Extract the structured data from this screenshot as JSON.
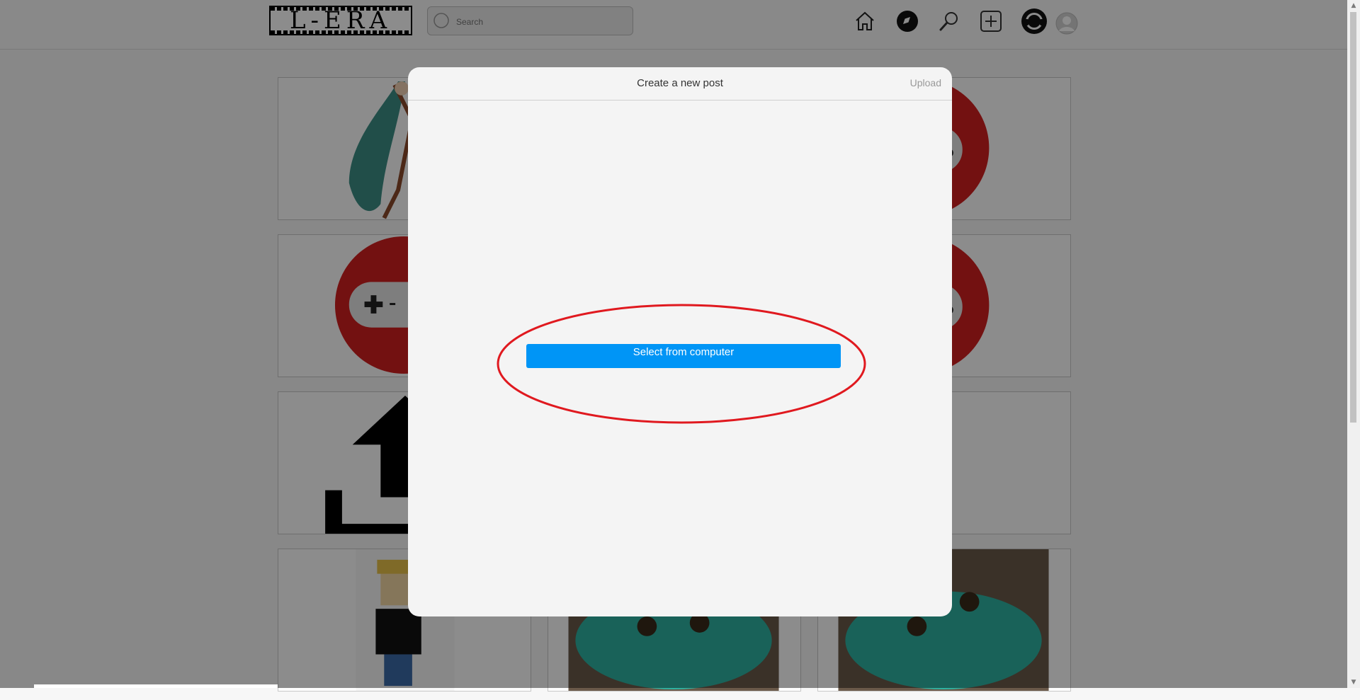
{
  "nav": {
    "logo_text": "L-ERA",
    "search_placeholder": "Search",
    "icons": [
      "home-icon",
      "compass-icon",
      "search-icon",
      "create-plus-icon",
      "headset-icon",
      "profile-icon"
    ]
  },
  "modal": {
    "title": "Create a new post",
    "upload_label": "Upload",
    "select_button_label": "Select from computer"
  },
  "colors": {
    "accent_blue": "#0095f6",
    "annotation_red": "#e0191f",
    "controller_red": "#d21f1f"
  }
}
